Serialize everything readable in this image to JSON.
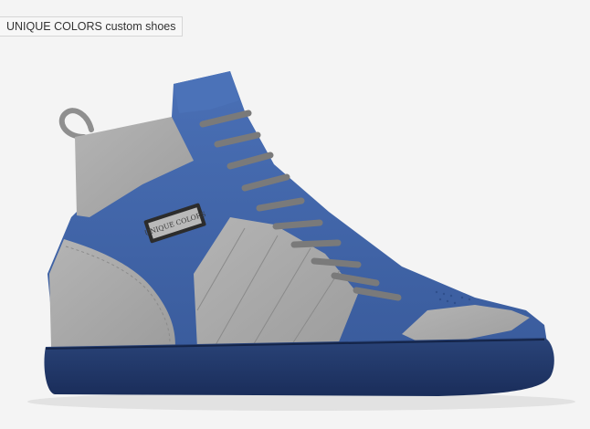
{
  "product": {
    "title": "UNIQUE COLORS custom shoes",
    "badge_text": "UNIQUE COLORS"
  },
  "colors": {
    "upper_blue": "#3e63a6",
    "panel_gray": "#a8a8a8",
    "sole_navy": "#1f3466",
    "lace_gray": "#7a7a7a",
    "background": "#f4f4f4"
  },
  "icons": [
    "high-top-sneaker"
  ]
}
